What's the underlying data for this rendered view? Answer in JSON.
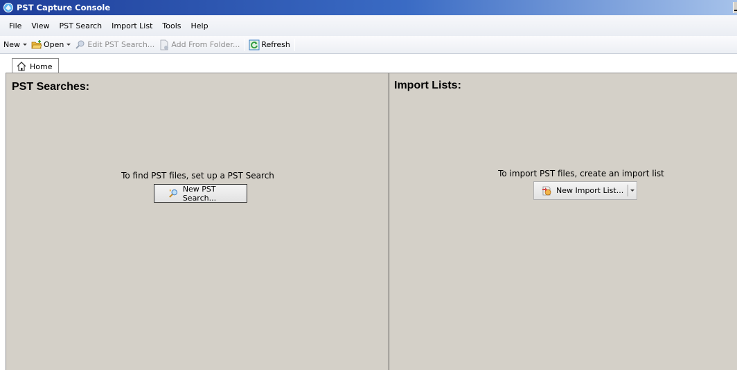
{
  "window": {
    "title": "PST Capture Console"
  },
  "menu": {
    "items": [
      "File",
      "View",
      "PST Search",
      "Import List",
      "Tools",
      "Help"
    ]
  },
  "toolbar": {
    "new_label": "New",
    "open_label": "Open",
    "edit_label": "Edit PST Search...",
    "add_label": "Add From Folder...",
    "refresh_label": "Refresh"
  },
  "tabs": [
    {
      "label": "Home"
    }
  ],
  "panels": {
    "searches": {
      "title": "PST Searches:",
      "prompt": "To find PST files, set up a PST Search",
      "button": "New PST Search..."
    },
    "imports": {
      "title": "Import Lists:",
      "prompt": "To import PST files, create an import list",
      "button": "New Import List..."
    }
  },
  "colors": {
    "titlebar": "#1f3f9a",
    "panel_bg": "#d4d0c8",
    "accent": "#3a6bc4"
  }
}
